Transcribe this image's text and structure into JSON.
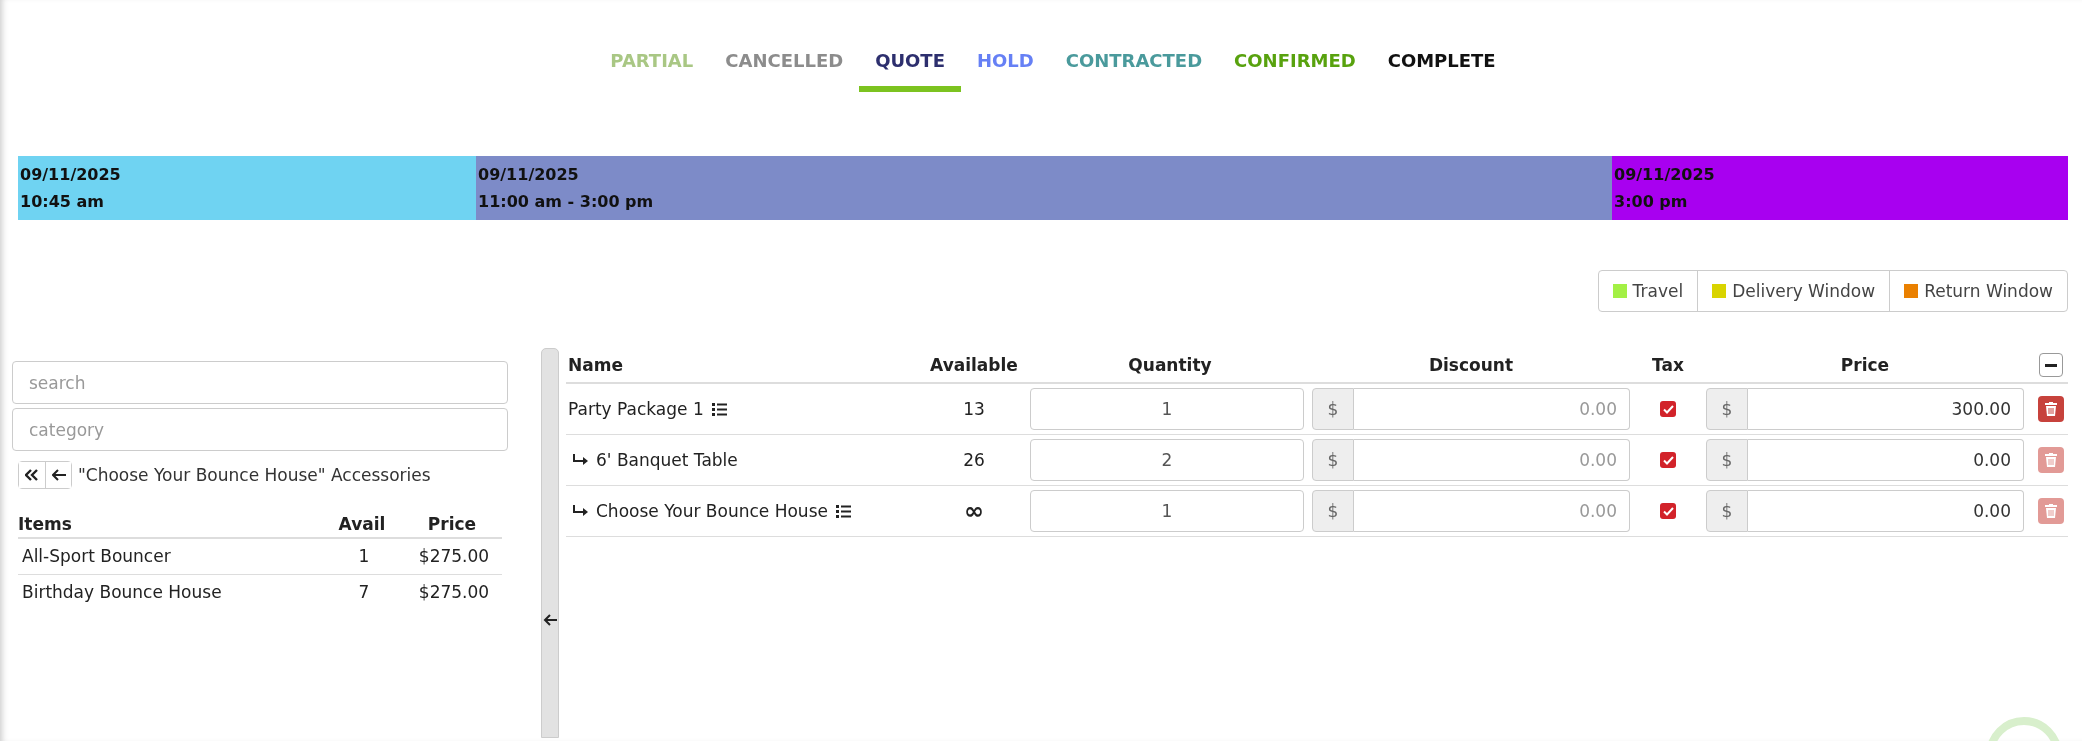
{
  "status_tabs": [
    {
      "label": "PARTIAL",
      "color": "#a9c784",
      "selected": false
    },
    {
      "label": "CANCELLED",
      "color": "#8c8c8c",
      "selected": false
    },
    {
      "label": "QUOTE",
      "color": "#2d2f6e",
      "selected": true
    },
    {
      "label": "HOLD",
      "color": "#6680f5",
      "selected": false
    },
    {
      "label": "CONTRACTED",
      "color": "#4a9a9c",
      "selected": false
    },
    {
      "label": "CONFIRMED",
      "color": "#58a20e",
      "selected": false
    },
    {
      "label": "COMPLETE",
      "color": "#111111",
      "selected": false
    }
  ],
  "timeline": [
    {
      "date": "09/11/2025",
      "time": "10:45 am",
      "color": "#6fd3f2"
    },
    {
      "date": "09/11/2025",
      "time": "11:00 am - 3:00 pm",
      "color": "#7d8bc8"
    },
    {
      "date": "09/11/2025",
      "time": "3:00 pm",
      "color": "#a800f0"
    }
  ],
  "legend": [
    {
      "label": "Travel",
      "color": "#a3f045"
    },
    {
      "label": "Delivery Window",
      "color": "#d9d400"
    },
    {
      "label": "Return Window",
      "color": "#ea8000"
    }
  ],
  "item_browser": {
    "search": {
      "placeholder": "search"
    },
    "category": {
      "placeholder": "category"
    },
    "title": "\"Choose Your Bounce House\" Accessories",
    "columns": [
      "Items",
      "Avail",
      "Price"
    ],
    "rows": [
      {
        "name": "All-Sport Bouncer",
        "avail": "1",
        "price": "$275.00"
      },
      {
        "name": "Birthday Bounce House",
        "avail": "7",
        "price": "$275.00"
      }
    ]
  },
  "order_table": {
    "columns": [
      "Name",
      "Available",
      "Quantity",
      "Discount",
      "Tax",
      "Price"
    ],
    "rows": [
      {
        "name": "Party Package 1",
        "child": false,
        "has_options": true,
        "available": "13",
        "quantity": "1",
        "discount_currency": "$",
        "discount": "0.00",
        "tax": true,
        "price_currency": "$",
        "price": "300.00",
        "delete_disabled": false
      },
      {
        "name": "6' Banquet Table",
        "child": true,
        "has_options": false,
        "available": "26",
        "quantity": "2",
        "discount_currency": "$",
        "discount": "0.00",
        "tax": true,
        "price_currency": "$",
        "price": "0.00",
        "delete_disabled": true
      },
      {
        "name": "Choose Your Bounce House",
        "child": true,
        "has_options": true,
        "available": "∞",
        "quantity": "1",
        "discount_currency": "$",
        "discount": "0.00",
        "tax": true,
        "price_currency": "$",
        "price": "0.00",
        "delete_disabled": true
      }
    ]
  }
}
